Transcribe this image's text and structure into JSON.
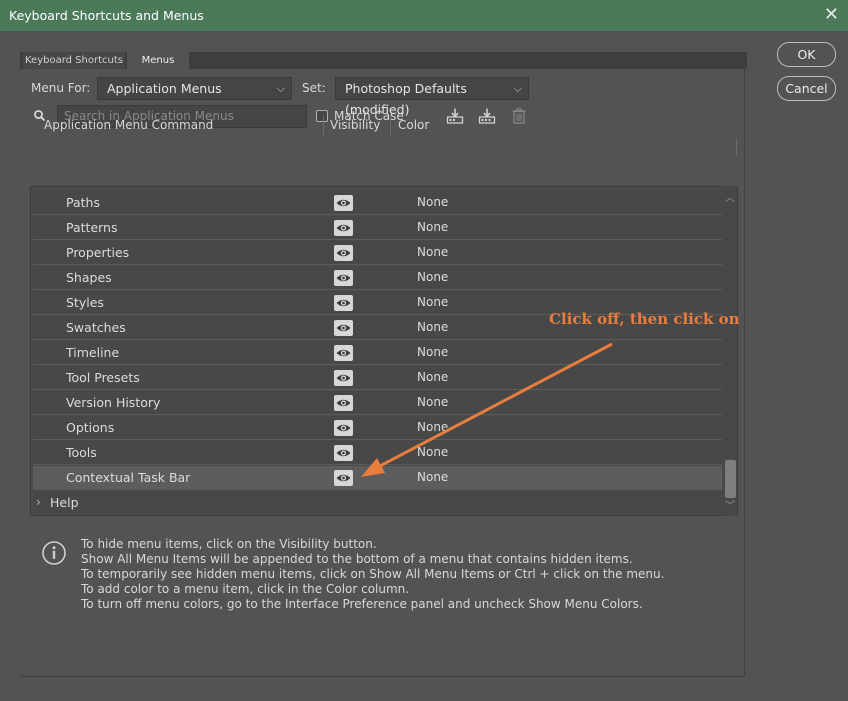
{
  "window": {
    "title": "Keyboard Shortcuts and Menus"
  },
  "tabs": [
    {
      "label": "Keyboard Shortcuts"
    },
    {
      "label": "Menus"
    }
  ],
  "menu_for": {
    "label": "Menu For:",
    "value": "Application Menus"
  },
  "set": {
    "label": "Set:",
    "value": "Photoshop Defaults (modified)"
  },
  "search": {
    "placeholder": "Search in Application Menus",
    "match_case_label": "Match Case"
  },
  "buttons": {
    "ok": "OK",
    "cancel": "Cancel"
  },
  "table": {
    "headers": {
      "command": "Application Menu Command",
      "visibility": "Visibility",
      "color": "Color"
    },
    "rows": [
      {
        "name": "Paths",
        "color": "None"
      },
      {
        "name": "Patterns",
        "color": "None"
      },
      {
        "name": "Properties",
        "color": "None"
      },
      {
        "name": "Shapes",
        "color": "None"
      },
      {
        "name": "Styles",
        "color": "None"
      },
      {
        "name": "Swatches",
        "color": "None"
      },
      {
        "name": "Timeline",
        "color": "None"
      },
      {
        "name": "Tool Presets",
        "color": "None"
      },
      {
        "name": "Version History",
        "color": "None"
      },
      {
        "name": "Options",
        "color": "None"
      },
      {
        "name": "Tools",
        "color": "None"
      },
      {
        "name": "Contextual Task Bar",
        "color": "None",
        "selected": true
      }
    ],
    "help_row": {
      "name": "Help"
    }
  },
  "info_lines": [
    "To hide menu items, click on the Visibility button.",
    "Show All Menu Items will be appended to the bottom of a menu that contains hidden items.",
    "To temporarily see hidden menu items, click on Show All Menu Items or Ctrl + click on the menu.",
    "To add color to a menu item, click in the Color column.",
    "To turn off menu colors, go to the Interface Preference panel and uncheck Show Menu Colors."
  ],
  "annotation": {
    "text": "Click off, then click on",
    "color": "#e87d3e"
  },
  "colors": {
    "titlebar": "#4b7a59",
    "dialog_bg": "#535353"
  }
}
